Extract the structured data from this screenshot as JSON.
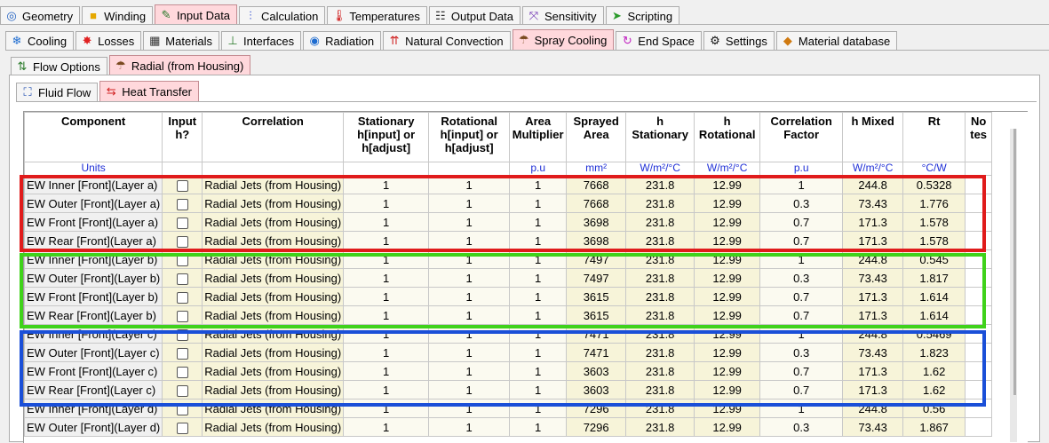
{
  "tabs_main": [
    {
      "label": "Geometry",
      "icon": "geometry-icon",
      "glyph": "◎",
      "color": "#1f5fc0"
    },
    {
      "label": "Winding",
      "icon": "winding-icon",
      "glyph": "■",
      "color": "#e5a800"
    },
    {
      "label": "Input Data",
      "icon": "input-data-icon",
      "glyph": "✎",
      "color": "#2b7a2b",
      "active": true
    },
    {
      "label": "Calculation",
      "icon": "calculation-icon",
      "glyph": "⫶",
      "color": "#1f3fd0"
    },
    {
      "label": "Temperatures",
      "icon": "thermometer-icon",
      "glyph": "🌡",
      "color": "#d02020"
    },
    {
      "label": "Output Data",
      "icon": "output-data-icon",
      "glyph": "☷",
      "color": "#333"
    },
    {
      "label": "Sensitivity",
      "icon": "sensitivity-icon",
      "glyph": "⤧",
      "color": "#6a2ab0"
    },
    {
      "label": "Scripting",
      "icon": "scripting-icon",
      "glyph": "➤",
      "color": "#2a9a2a"
    }
  ],
  "tabs_input": [
    {
      "label": "Cooling",
      "icon": "snowflake-icon",
      "glyph": "❄",
      "color": "#1e6cd0"
    },
    {
      "label": "Losses",
      "icon": "losses-icon",
      "glyph": "✸",
      "color": "#e02020"
    },
    {
      "label": "Materials",
      "icon": "materials-icon",
      "glyph": "▦",
      "color": "#333"
    },
    {
      "label": "Interfaces",
      "icon": "interfaces-icon",
      "glyph": "⊥",
      "color": "#2a7a2a"
    },
    {
      "label": "Radiation",
      "icon": "radiation-icon",
      "glyph": "◉",
      "color": "#1e6cd0"
    },
    {
      "label": "Natural Convection",
      "icon": "natural-convection-icon",
      "glyph": "⇈",
      "color": "#d02020"
    },
    {
      "label": "Spray Cooling",
      "icon": "spray-cooling-icon",
      "glyph": "☂",
      "color": "#7a4a20",
      "active": true
    },
    {
      "label": "End Space",
      "icon": "end-space-icon",
      "glyph": "↻",
      "color": "#c020c0"
    },
    {
      "label": "Settings",
      "icon": "gear-icon",
      "glyph": "⚙",
      "color": "#111"
    },
    {
      "label": "Material database",
      "icon": "material-database-icon",
      "glyph": "◆",
      "color": "#d07a10"
    }
  ],
  "tabs_spray": [
    {
      "label": "Flow Options",
      "icon": "flow-options-icon",
      "glyph": "⇅",
      "color": "#2a7a2a"
    },
    {
      "label": "Radial (from Housing)",
      "icon": "radial-housing-icon",
      "glyph": "☂",
      "color": "#7a4a20",
      "active": true
    }
  ],
  "tabs_radial": [
    {
      "label": "Fluid Flow",
      "icon": "fluid-flow-icon",
      "glyph": "⛶",
      "color": "#1e4cb0"
    },
    {
      "label": "Heat Transfer",
      "icon": "heat-transfer-icon",
      "glyph": "⇆",
      "color": "#d02020",
      "active": true
    }
  ],
  "table": {
    "headers": [
      "Component",
      "Input h?",
      "Correlation",
      "Stationary h[input] or h[adjust]",
      "Rotational h[input] or h[adjust]",
      "Area Multiplier",
      "Sprayed Area",
      "h Stationary",
      "h Rotational",
      "Correlation Factor",
      "h Mixed",
      "Rt",
      "No tes"
    ],
    "units": [
      "Units",
      "",
      "",
      "",
      "",
      "p.u",
      "mm²",
      "W/m²/°C",
      "W/m²/°C",
      "p.u",
      "W/m²/°C",
      "°C/W",
      ""
    ],
    "rows": [
      [
        "EW Inner [Front](Layer a)",
        "Radial Jets (from Housing)",
        "1",
        "1",
        "1",
        "7668",
        "231.8",
        "12.99",
        "1",
        "244.8",
        "0.5328"
      ],
      [
        "EW Outer [Front](Layer a)",
        "Radial Jets (from Housing)",
        "1",
        "1",
        "1",
        "7668",
        "231.8",
        "12.99",
        "0.3",
        "73.43",
        "1.776"
      ],
      [
        "EW Front [Front](Layer a)",
        "Radial Jets (from Housing)",
        "1",
        "1",
        "1",
        "3698",
        "231.8",
        "12.99",
        "0.7",
        "171.3",
        "1.578"
      ],
      [
        "EW Rear [Front](Layer a)",
        "Radial Jets (from Housing)",
        "1",
        "1",
        "1",
        "3698",
        "231.8",
        "12.99",
        "0.7",
        "171.3",
        "1.578"
      ],
      [
        "EW Inner [Front](Layer b)",
        "Radial Jets (from Housing)",
        "1",
        "1",
        "1",
        "7497",
        "231.8",
        "12.99",
        "1",
        "244.8",
        "0.545"
      ],
      [
        "EW Outer [Front](Layer b)",
        "Radial Jets (from Housing)",
        "1",
        "1",
        "1",
        "7497",
        "231.8",
        "12.99",
        "0.3",
        "73.43",
        "1.817"
      ],
      [
        "EW Front [Front](Layer b)",
        "Radial Jets (from Housing)",
        "1",
        "1",
        "1",
        "3615",
        "231.8",
        "12.99",
        "0.7",
        "171.3",
        "1.614"
      ],
      [
        "EW Rear [Front](Layer b)",
        "Radial Jets (from Housing)",
        "1",
        "1",
        "1",
        "3615",
        "231.8",
        "12.99",
        "0.7",
        "171.3",
        "1.614"
      ],
      [
        "EW Inner [Front](Layer c)",
        "Radial Jets (from Housing)",
        "1",
        "1",
        "1",
        "7471",
        "231.8",
        "12.99",
        "1",
        "244.8",
        "0.5469"
      ],
      [
        "EW Outer [Front](Layer c)",
        "Radial Jets (from Housing)",
        "1",
        "1",
        "1",
        "7471",
        "231.8",
        "12.99",
        "0.3",
        "73.43",
        "1.823"
      ],
      [
        "EW Front [Front](Layer c)",
        "Radial Jets (from Housing)",
        "1",
        "1",
        "1",
        "3603",
        "231.8",
        "12.99",
        "0.7",
        "171.3",
        "1.62"
      ],
      [
        "EW Rear [Front](Layer c)",
        "Radial Jets (from Housing)",
        "1",
        "1",
        "1",
        "3603",
        "231.8",
        "12.99",
        "0.7",
        "171.3",
        "1.62"
      ],
      [
        "EW Inner [Front](Layer d)",
        "Radial Jets (from Housing)",
        "1",
        "1",
        "1",
        "7296",
        "231.8",
        "12.99",
        "1",
        "244.8",
        "0.56"
      ],
      [
        "EW Outer [Front](Layer d)",
        "Radial Jets (from Housing)",
        "1",
        "1",
        "1",
        "7296",
        "231.8",
        "12.99",
        "0.3",
        "73.43",
        "1.867"
      ]
    ]
  },
  "highlight_colors": {
    "layer_a": "#e01b1b",
    "layer_b": "#3fd21a",
    "layer_c": "#1a4fd8"
  }
}
